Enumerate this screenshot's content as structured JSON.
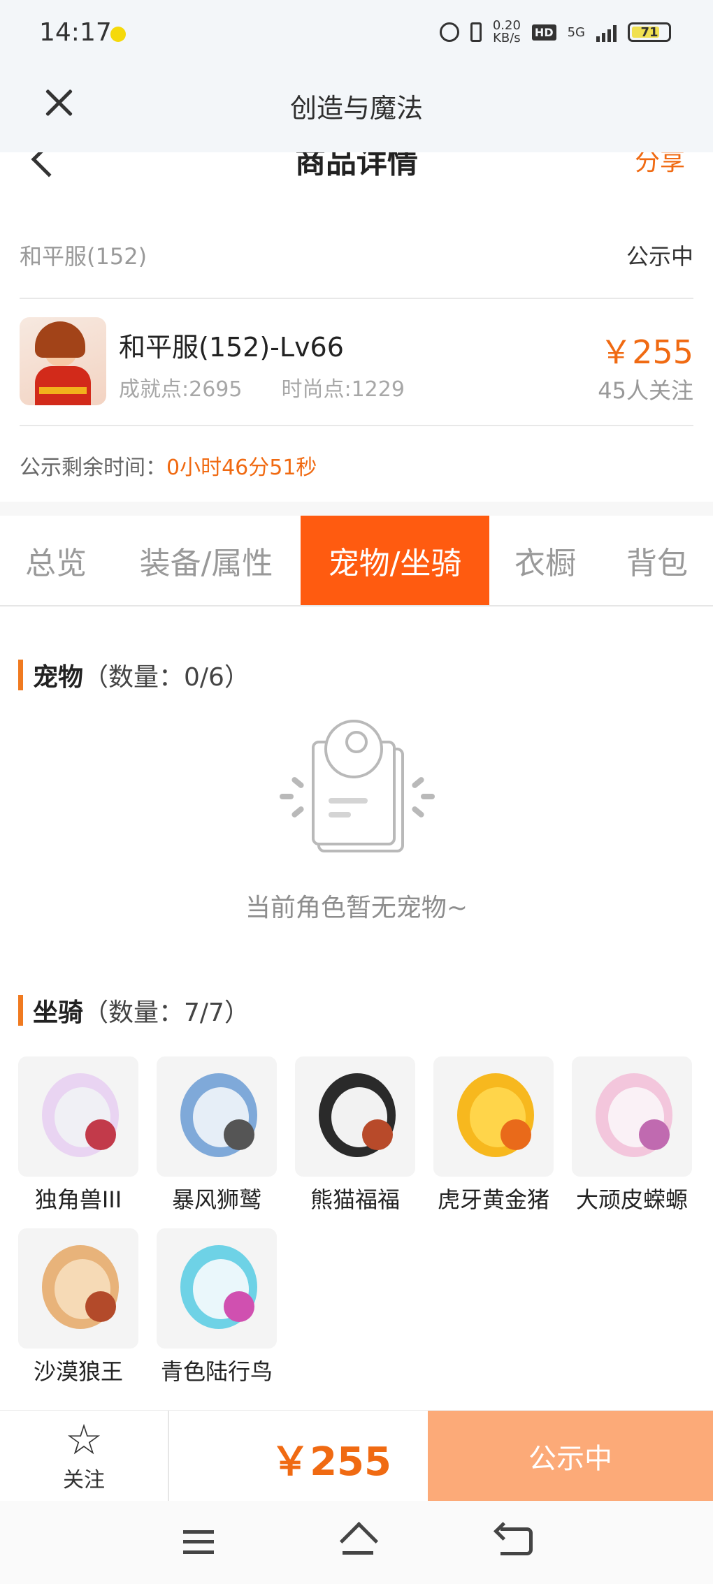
{
  "status_bar": {
    "time": "14:17",
    "net_speed_value": "0.20",
    "net_speed_unit": "KB/s",
    "hd_label": "HD",
    "network_label": "5G",
    "battery_level": "71"
  },
  "webview": {
    "title": "创造与魔法",
    "close_icon": "close-icon"
  },
  "page_header": {
    "title": "商品详情",
    "share_label": "分享",
    "back_icon": "chevron-left-icon"
  },
  "listing": {
    "server_name": "和平服(152)",
    "status": "公示中",
    "item_title": "和平服(152)-Lv66",
    "achievement_points": "成就点:2695",
    "fashion_points": "时尚点:1229",
    "price": "￥255",
    "followers": "45人关注",
    "countdown_label": "公示剩余时间：",
    "countdown_value": "0小时46分51秒"
  },
  "tabs": [
    {
      "label": "总览",
      "active": false
    },
    {
      "label": "装备/属性",
      "active": false
    },
    {
      "label": "宠物/坐骑",
      "active": true
    },
    {
      "label": "衣橱",
      "active": false
    },
    {
      "label": "背包",
      "active": false
    }
  ],
  "pets": {
    "heading": "宠物",
    "count": "（数量：0/6）",
    "empty_text": "当前角色暂无宠物~",
    "empty_icon": "empty-profile-card-icon"
  },
  "mounts": {
    "heading": "坐骑",
    "count": "（数量：7/7）",
    "items": [
      {
        "name": "独角兽III",
        "colors": [
          "#e9d4f2",
          "#f0f0f5",
          "#c23a4a"
        ]
      },
      {
        "name": "暴风狮鹫",
        "colors": [
          "#7fa9d9",
          "#e6eef7",
          "#555555"
        ]
      },
      {
        "name": "熊猫福福",
        "colors": [
          "#2a2a2a",
          "#f2f2f2",
          "#b84a2a"
        ]
      },
      {
        "name": "虎牙黄金猪",
        "colors": [
          "#f7b81e",
          "#ffd54a",
          "#e96a1a"
        ]
      },
      {
        "name": "大顽皮蝾螈",
        "colors": [
          "#f3c6dc",
          "#faf1f6",
          "#c06ab0"
        ]
      },
      {
        "name": "沙漠狼王",
        "colors": [
          "#e8b37a",
          "#f6dab6",
          "#b34a2a"
        ]
      },
      {
        "name": "青色陆行鸟",
        "colors": [
          "#6ed2e6",
          "#eaf7fb",
          "#d050b0"
        ]
      }
    ]
  },
  "action_bar": {
    "follow_label": "关注",
    "follow_icon": "star-icon",
    "price": "￥255",
    "cta_label": "公示中"
  },
  "nav_bar": {
    "icons": [
      "menu-icon",
      "home-icon",
      "back-icon"
    ]
  },
  "colors": {
    "accent": "#ff5b10",
    "price": "#f06a12",
    "cta": "#fcaa78"
  }
}
